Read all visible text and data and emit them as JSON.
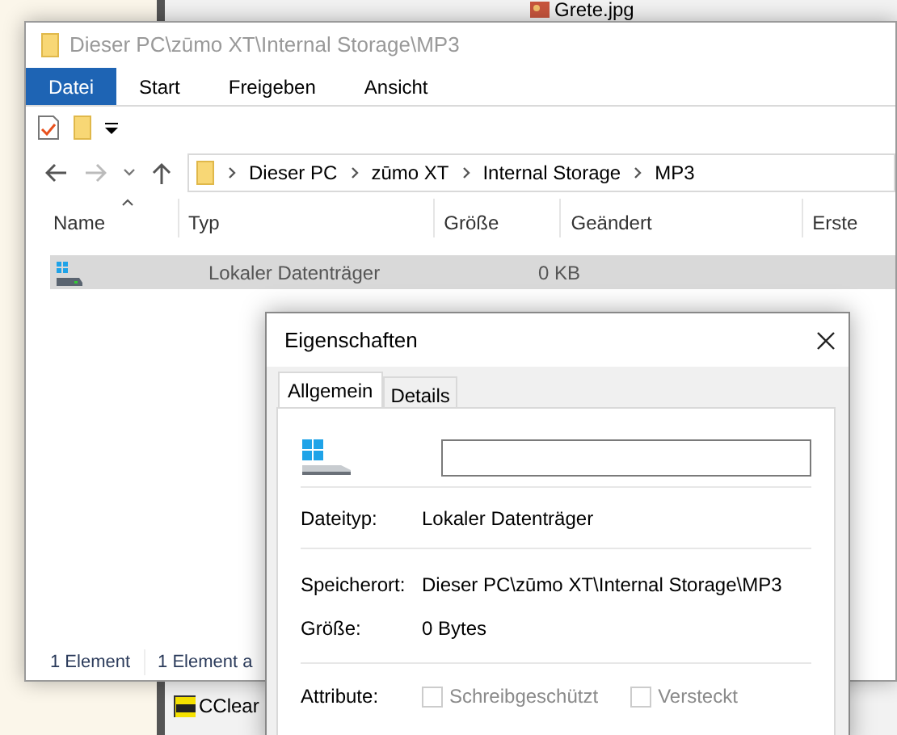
{
  "background": {
    "items": [
      {
        "label": "Grete.jpg",
        "kind": "image"
      },
      {
        "label": "CClear",
        "kind": "pdf"
      }
    ]
  },
  "explorer": {
    "title": "Dieser PC\\zūmo XT\\Internal Storage\\MP3",
    "ribbon_tabs": [
      {
        "label": "Datei",
        "selected": true
      },
      {
        "label": "Start",
        "selected": false
      },
      {
        "label": "Freigeben",
        "selected": false
      },
      {
        "label": "Ansicht",
        "selected": false
      }
    ],
    "address": [
      "Dieser PC",
      "zūmo XT",
      "Internal Storage",
      "MP3"
    ],
    "columns": [
      "Name",
      "Typ",
      "Größe",
      "Geändert",
      "Erste"
    ],
    "rows": [
      {
        "type": "Lokaler Datenträger",
        "size": "0 KB",
        "selected": true
      }
    ],
    "status": [
      "1 Element",
      "1 Element a"
    ]
  },
  "dialog": {
    "title": "Eigenschaften",
    "tabs": [
      {
        "label": "Allgemein",
        "selected": true
      },
      {
        "label": "Details",
        "selected": false
      }
    ],
    "fields": [
      {
        "label": "Dateityp:",
        "value": "Lokaler Datenträger"
      },
      {
        "label": "Speicherort:",
        "value": "Dieser PC\\zūmo XT\\Internal Storage\\MP3"
      },
      {
        "label": "Größe:",
        "value": "0 Bytes"
      }
    ],
    "attributes": {
      "label": "Attribute:",
      "options": [
        {
          "label": "Schreibgeschützt",
          "checked": false,
          "disabled": true
        },
        {
          "label": "Versteckt",
          "checked": false,
          "disabled": true
        }
      ]
    }
  }
}
